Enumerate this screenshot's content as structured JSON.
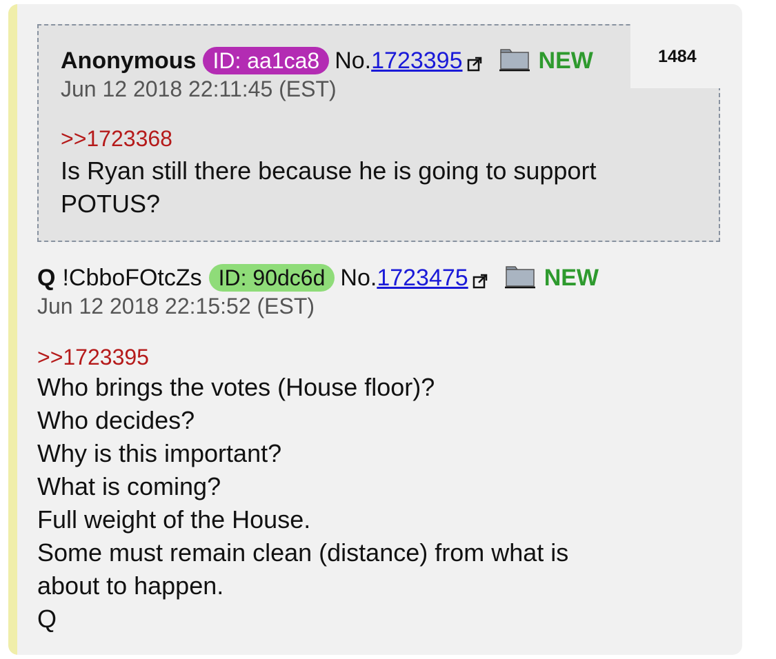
{
  "quoted_post": {
    "name": "Anonymous",
    "id_label": "ID: aa1ca8",
    "no_label": "No.",
    "post_no": "1723395",
    "new_label": "NEW",
    "date": "Jun 12 2018 22:11:45 (EST)",
    "reply_ref": ">>1723368",
    "body_lines": [
      "Is Ryan still there because he is going to support",
      "POTUS?"
    ]
  },
  "post_count": "1484",
  "main_post": {
    "name": "Q",
    "tripcode": "!CbboFOtcZs",
    "id_label": "ID: 90dc6d",
    "no_label": "No.",
    "post_no": "1723475",
    "new_label": "NEW",
    "date": "Jun 12 2018 22:15:52 (EST)",
    "reply_ref": ">>1723395",
    "body_lines": [
      "Who brings the votes (House floor)?",
      "Who decides?",
      "Why is this important?",
      "What is coming?",
      "Full weight of the House.",
      "Some must remain clean (distance) from what is",
      "about to happen.",
      "Q"
    ]
  },
  "colors": {
    "id_quoted": "#b32cb3",
    "id_main": "#8fdc79",
    "new": "#2e9a2e",
    "reply_ref": "#b51a1a",
    "link": "#1a1ad8",
    "accent_bar": "#f0eeaa"
  },
  "icons": {
    "external_link": "external-link-icon",
    "folder": "folder-icon"
  }
}
